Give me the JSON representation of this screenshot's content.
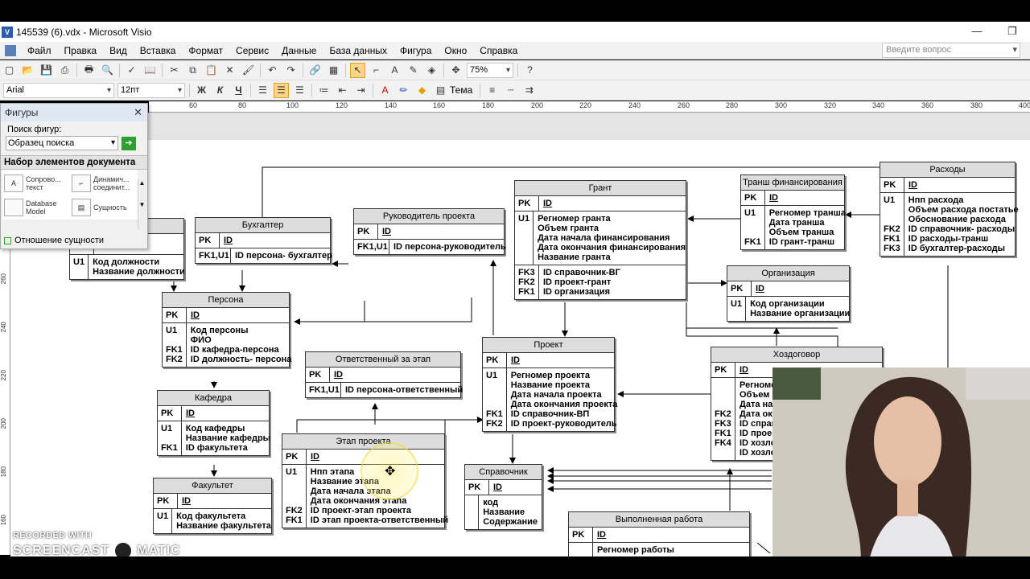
{
  "window": {
    "title": "145539 (6).vdx - Microsoft Visio",
    "minimize": "—",
    "restore": "❐"
  },
  "menu": {
    "items": [
      "Файл",
      "Правка",
      "Вид",
      "Вставка",
      "Формат",
      "Сервис",
      "Данные",
      "База данных",
      "Фигура",
      "Окно",
      "Справка"
    ],
    "question_placeholder": "Введите вопрос"
  },
  "toolbar": {
    "zoom": "75%",
    "font": "Arial",
    "size": "12пт",
    "theme": "Тема"
  },
  "ruler": {
    "h": [
      "60",
      "80",
      "100",
      "120",
      "140",
      "160",
      "180",
      "200",
      "220",
      "240",
      "260",
      "280",
      "300",
      "320",
      "340",
      "360",
      "380",
      "400"
    ],
    "v": [
      "260",
      "240",
      "220",
      "200",
      "180",
      "160"
    ]
  },
  "shapes_panel": {
    "title": "Фигуры",
    "search_label": "Поиск фигур:",
    "search_value": "Образец поиска",
    "stencil": "Набор элементов документа",
    "items": [
      {
        "label": "Сопрово... текст",
        "icon": "text-icon"
      },
      {
        "label": "Динамич... соединит...",
        "icon": "connector-icon"
      },
      {
        "label": "Database Model",
        "icon": "database-icon"
      },
      {
        "label": "Сущность",
        "icon": "entity-icon"
      }
    ],
    "bottom": "Отношение сущности"
  },
  "entities": {
    "dolzhnost": {
      "rows": [
        [
          "U1",
          "Код должности\nНазвание должности"
        ]
      ]
    },
    "buhgalter": {
      "title": "Бухгалтер",
      "rows": [
        [
          "PK",
          "ID"
        ],
        [
          "FK1,U1",
          "ID персона- бухгалтер"
        ]
      ]
    },
    "rukovoditel": {
      "title": "Руководитель проекта",
      "rows": [
        [
          "PK",
          "ID"
        ],
        [
          "FK1,U1",
          "ID персона-руководитель"
        ]
      ]
    },
    "grant": {
      "title": "Грант",
      "rows": [
        [
          "PK",
          "ID"
        ],
        [
          "U1",
          "Регномер гранта\nОбъем гранта\nДата начала финансирования\nДата окончания финансирования\nНазвание гранта"
        ],
        [
          "FK3\nFK2\nFK1",
          "ID справочник-ВГ\nID проект-грант\nID организация"
        ]
      ]
    },
    "transh": {
      "title": "Транш финансирования",
      "rows": [
        [
          "PK",
          "ID"
        ],
        [
          "U1\n\n\nFK1",
          "Регномер транша\nДата транша\nОбъем транша\nID грант-транш"
        ]
      ]
    },
    "rashody": {
      "title": "Расходы",
      "rows": [
        [
          "PK",
          "ID"
        ],
        [
          "U1\n\n\nFK2\nFK1\nFK3",
          "Нпп расхода\nОбъем расхода постатье\nОбоснование расхода\nID справочник- расходы\nID расходы-транш\nID бухгалтер-расходы"
        ]
      ]
    },
    "persona": {
      "title": "Персона",
      "rows": [
        [
          "PK",
          "ID"
        ],
        [
          "U1\n\nFK1\nFK2",
          "Код персоны\nФИО\nID кафедра-персона\nID должность- персона"
        ]
      ]
    },
    "organizacia": {
      "title": "Организация",
      "rows": [
        [
          "PK",
          "ID"
        ],
        [
          "U1",
          "Код организации\nНазвание организации"
        ]
      ]
    },
    "otvetstvenny": {
      "title": "Ответственный за этап",
      "rows": [
        [
          "PK",
          "ID"
        ],
        [
          "FK1,U1",
          "ID персона-ответственный"
        ]
      ]
    },
    "proekt": {
      "title": "Проект",
      "rows": [
        [
          "PK",
          "ID"
        ],
        [
          "U1\n\n\n\nFK1\nFK2",
          "Регномер проекта\nНазвание проекта\nДата начала проекта\nДата окончания проекта\nID справочник-ВП\nID проект-руководитель"
        ]
      ]
    },
    "hozdogovor": {
      "title": "Хоздоговор",
      "rows": [
        [
          "PK",
          "ID"
        ],
        [
          "\n\n\nFK2\nFK3\nFK1\nFK4",
          "Регноме\nОбъем х\nДата на\nДата око\nID справ\nID проек\nID хозло\nID хозло"
        ]
      ]
    },
    "kafedra": {
      "title": "Кафедра",
      "rows": [
        [
          "PK",
          "ID"
        ],
        [
          "U1\n\nFK1",
          "Код кафедры\nНазвание кафедры\nID факультета"
        ]
      ]
    },
    "etap": {
      "title": "Этап проекта",
      "rows": [
        [
          "PK",
          "ID"
        ],
        [
          "U1\n\n\n\nFK2\nFK1",
          "Нпп этапа\nНазвание этапа\nДата начала этапа\nДата окончания этапа\nID проект-этап проекта\nID этап проекта-ответственный"
        ]
      ]
    },
    "spravochnik": {
      "title": "Справочник",
      "rows": [
        [
          "PK",
          "ID"
        ],
        [
          "",
          "код\nНазвание\nСодержание"
        ]
      ]
    },
    "fakultet": {
      "title": "Факультет",
      "rows": [
        [
          "PK",
          "ID"
        ],
        [
          "U1",
          "Код факультета\nНазвание факультета"
        ]
      ]
    },
    "vypolnennaya": {
      "title": "Выполненная работа",
      "rows": [
        [
          "PK",
          "ID"
        ],
        [
          "",
          "Регномер работы"
        ]
      ]
    }
  },
  "watermark": {
    "line1": "RECORDED WITH",
    "line2a": "SCREENCAST",
    "line2b": "MATIC"
  }
}
